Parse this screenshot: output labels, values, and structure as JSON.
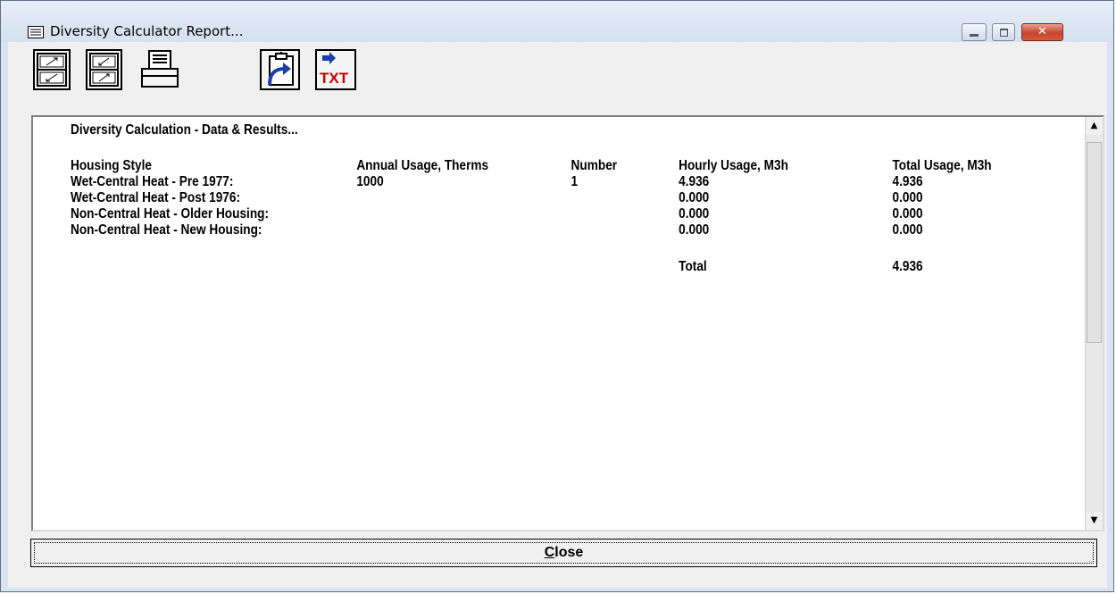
{
  "window": {
    "title": "Diversity Calculator Report..."
  },
  "toolbar": {
    "buttons": [
      {
        "name": "expand-icon"
      },
      {
        "name": "collapse-icon"
      },
      {
        "name": "printer-icon"
      },
      {
        "name": "copy-to-clipboard-icon"
      },
      {
        "name": "export-txt-icon",
        "label": "TXT"
      }
    ]
  },
  "report": {
    "heading": "Diversity Calculation - Data & Results...",
    "columns": [
      "Housing Style",
      "Annual Usage, Therms",
      "Number",
      "Hourly Usage, M3h",
      "Total Usage, M3h"
    ],
    "rows": [
      {
        "style": "Wet-Central Heat - Pre 1977:",
        "annual": "1000",
        "number": "1",
        "hourly": "4.936",
        "total": "4.936"
      },
      {
        "style": "Wet-Central Heat - Post 1976:",
        "annual": "",
        "number": "",
        "hourly": "0.000",
        "total": "0.000"
      },
      {
        "style": "Non-Central Heat - Older Housing:",
        "annual": "",
        "number": "",
        "hourly": "0.000",
        "total": "0.000"
      },
      {
        "style": "Non-Central Heat - New Housing:",
        "annual": "",
        "number": "",
        "hourly": "0.000",
        "total": "0.000"
      }
    ],
    "total_label": "Total",
    "total_value": "4.936"
  },
  "close_button": {
    "accel": "C",
    "rest": "lose"
  },
  "colors": {
    "txt_red": "#cc0000",
    "arrow_blue": "#1a3fa8",
    "close_red": "#c8452f"
  }
}
